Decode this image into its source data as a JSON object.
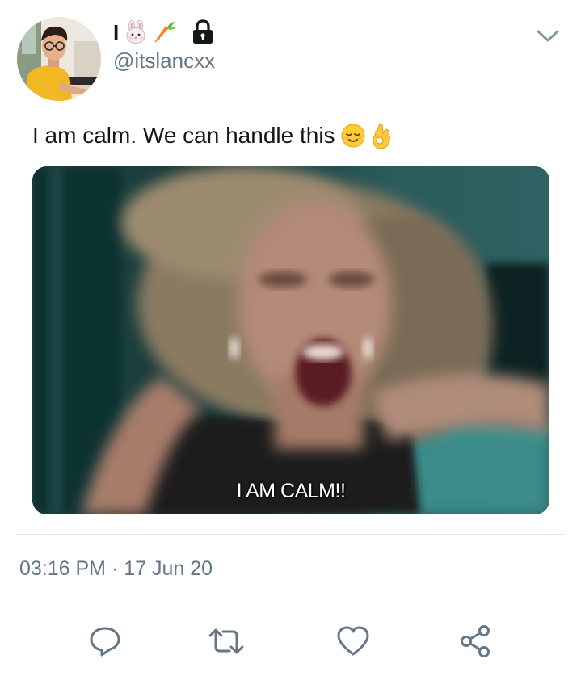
{
  "user": {
    "display_name": "I",
    "name_emojis": [
      "rabbit-face-emoji",
      "carrot-emoji"
    ],
    "protected_icon": "lock-icon",
    "handle": "@itslancxx",
    "avatar": "profile-avatar"
  },
  "tweet": {
    "text": "I am calm. We can handle this",
    "text_emojis": [
      "relieved-face-emoji",
      "ok-hand-emoji"
    ],
    "media": {
      "subtitle": "I AM CALM!!"
    },
    "timestamp": "03:16 PM · 17 Jun 20"
  },
  "actions": [
    {
      "name": "reply",
      "icon": "comment-icon"
    },
    {
      "name": "retweet",
      "icon": "retweet-icon"
    },
    {
      "name": "like",
      "icon": "heart-icon"
    },
    {
      "name": "share",
      "icon": "share-icon"
    }
  ],
  "colors": {
    "primary_text": "#14171a",
    "secondary_text": "#657786",
    "divider": "#e1e8ed",
    "icon": "#657786"
  }
}
